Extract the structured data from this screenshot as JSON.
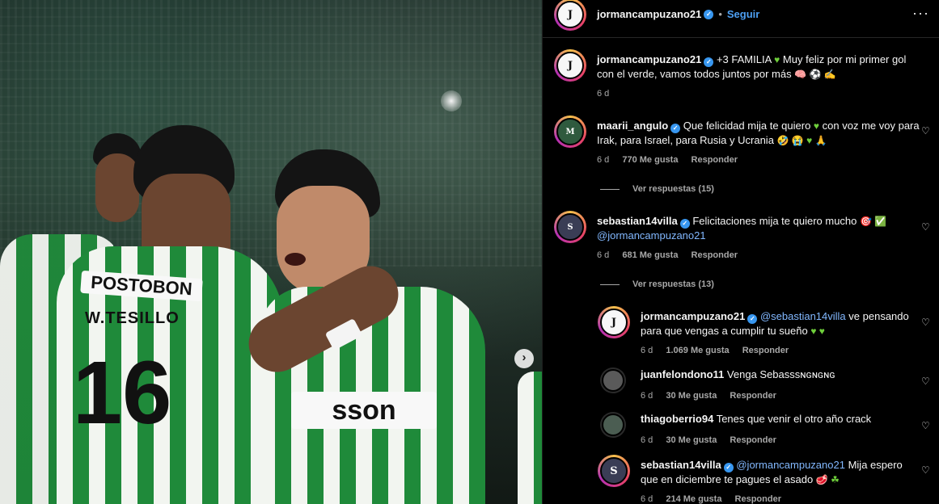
{
  "post": {
    "author": "jormancampuzano21",
    "follow_label": "Seguir",
    "more_label": "···",
    "caption_text": "+3 FAMILIA",
    "caption_rest": "Muy feliz por mi primer gol con el verde, vamos todos juntos por más",
    "caption_time": "6 d"
  },
  "photo": {
    "sponsor_left": "POSTOBON",
    "name_back": "W.TESILLO",
    "number_back": "16",
    "sponsor_front": "sson",
    "next_label": "›"
  },
  "comments": [
    {
      "user": "maarii_angulo",
      "text_1": "Que felicidad mija te quiero",
      "text_2": "con voz me voy para Irak, para Israel, para Rusia y Ucrania",
      "time": "6 d",
      "likes": "770 Me gusta",
      "reply_label": "Responder",
      "view_replies": "Ver respuestas (15)"
    },
    {
      "user": "sebastian14villa",
      "text_1": "Felicitaciones mija te quiero mucho",
      "mention": "@jormancampuzano21",
      "time": "6 d",
      "likes": "681 Me gusta",
      "reply_label": "Responder",
      "view_replies": "Ver respuestas (13)"
    }
  ],
  "replies": [
    {
      "user": "jormancampuzano21",
      "mention": "@sebastian14villa",
      "text": "ve pensando para que vengas a cumplir tu sueño",
      "time": "6 d",
      "likes": "1.069 Me gusta",
      "reply_label": "Responder"
    },
    {
      "user": "juanfelondono11",
      "text": "Venga Sebasssɴɢɴɢɴɢ",
      "time": "6 d",
      "likes": "30 Me gusta",
      "reply_label": "Responder"
    },
    {
      "user": "thiagoberrio94",
      "text": "Tenes que venir el otro año crack",
      "time": "6 d",
      "likes": "30 Me gusta",
      "reply_label": "Responder"
    },
    {
      "user": "sebastian14villa",
      "mention": "@jormancampuzano21",
      "text": "Mija espero que en diciembre te pagues el asado",
      "time": "6 d",
      "likes": "214 Me gusta",
      "reply_label": "Responder"
    }
  ],
  "icons": {
    "verified": "verified-badge-icon",
    "heart": "heart-outline-icon",
    "more": "more-options-icon",
    "carousel_next": "chevron-right-icon"
  },
  "colors": {
    "link": "#4d9ff2",
    "mention": "#82b8ff",
    "muted": "#a8a8a8",
    "jersey_green": "#1f8a3a"
  }
}
